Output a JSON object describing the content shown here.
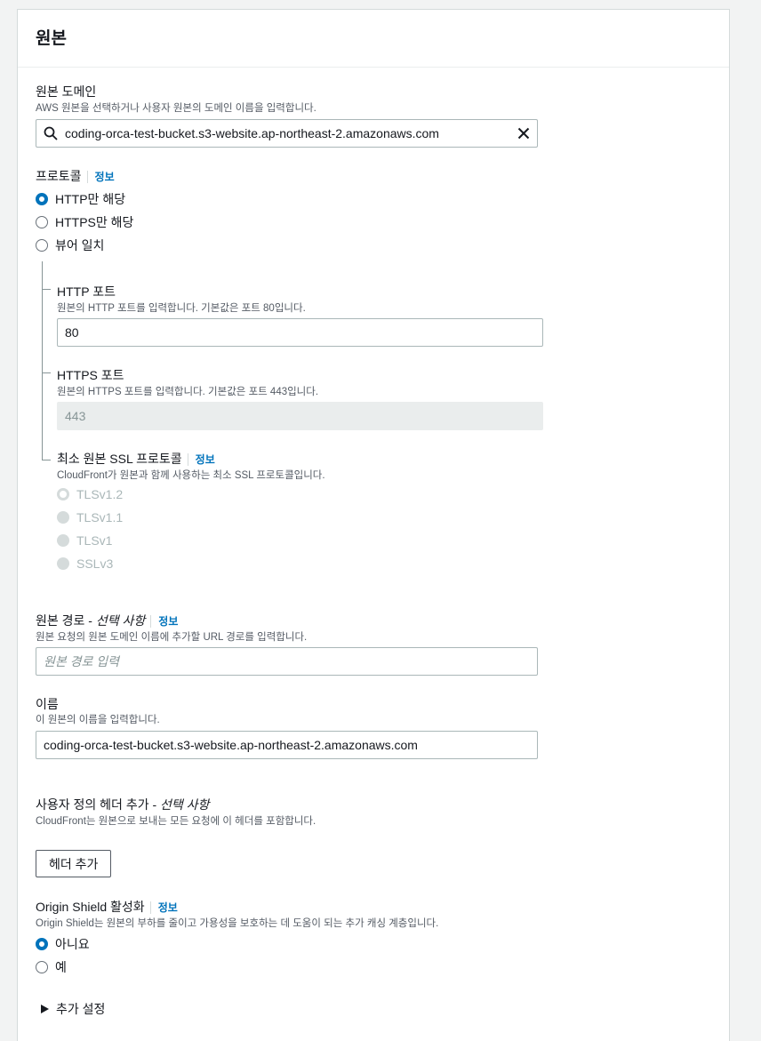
{
  "section": {
    "title": "원본"
  },
  "origin_domain": {
    "label": "원본 도메인",
    "description": "AWS 원본을 선택하거나 사용자 원본의 도메인 이름을 입력합니다.",
    "value": "coding-orca-test-bucket.s3-website.ap-northeast-2.amazonaws.com"
  },
  "protocol": {
    "label": "프로토콜",
    "info": "정보",
    "options": [
      "HTTP만 해당",
      "HTTPS만 해당",
      "뷰어 일치"
    ],
    "selected": "HTTP만 해당"
  },
  "http_port": {
    "label": "HTTP 포트",
    "description": "원본의 HTTP 포트를 입력합니다. 기본값은 포트 80입니다.",
    "value": "80"
  },
  "https_port": {
    "label": "HTTPS 포트",
    "description": "원본의 HTTPS 포트를 입력합니다. 기본값은 포트 443입니다.",
    "value": "443"
  },
  "ssl_protocol": {
    "label": "최소 원본 SSL 프로토콜",
    "info": "정보",
    "description": "CloudFront가 원본과 함께 사용하는 최소 SSL 프로토콜입니다.",
    "options": [
      "TLSv1.2",
      "TLSv1.1",
      "TLSv1",
      "SSLv3"
    ],
    "selected": "TLSv1.2"
  },
  "origin_path": {
    "label": "원본 경로 - ",
    "optional": "선택 사항",
    "info": "정보",
    "description": "원본 요청의 원본 도메인 이름에 추가할 URL 경로를 입력합니다.",
    "placeholder": "원본 경로 입력"
  },
  "name": {
    "label": "이름",
    "description": "이 원본의 이름을 입력합니다.",
    "value": "coding-orca-test-bucket.s3-website.ap-northeast-2.amazonaws.com"
  },
  "custom_headers": {
    "label": "사용자 정의 헤더 추가 - ",
    "optional": "선택 사항",
    "description": "CloudFront는 원본으로 보내는 모든 요청에 이 헤더를 포함합니다.",
    "button": "헤더 추가"
  },
  "origin_shield": {
    "label": "Origin Shield 활성화",
    "info": "정보",
    "description": "Origin Shield는 원본의 부하를 줄이고 가용성을 보호하는 데 도움이 되는 추가 캐싱 계층입니다.",
    "options": [
      "아니요",
      "예"
    ],
    "selected": "아니요"
  },
  "additional_settings": {
    "label": "추가 설정"
  },
  "colors": {
    "accent": "#0073bb",
    "link": "#0073bb",
    "border": "#aab7b8"
  }
}
